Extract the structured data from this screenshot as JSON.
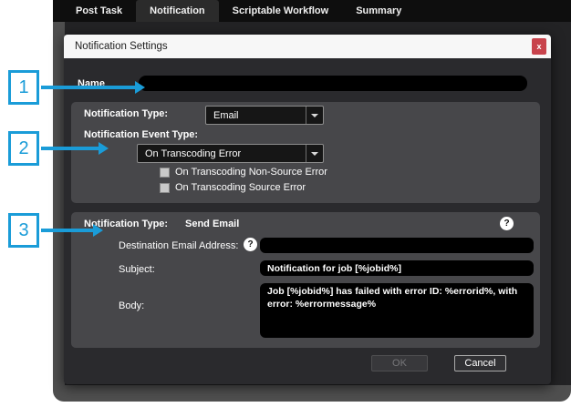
{
  "colors": {
    "accent_blue": "#1a9cd8",
    "close_red": "#c8434c",
    "dialog_bg": "#2a2a2d",
    "section_bg": "#47474a"
  },
  "tabs": [
    {
      "label": "Post Task",
      "selected": false
    },
    {
      "label": "Notification",
      "selected": true
    },
    {
      "label": "Scriptable Workflow",
      "selected": false
    },
    {
      "label": "Summary",
      "selected": false
    }
  ],
  "annotations": [
    {
      "number": "1"
    },
    {
      "number": "2"
    },
    {
      "number": "3"
    }
  ],
  "dialog": {
    "title": "Notification Settings",
    "close_glyph": "x",
    "name": {
      "label": "Name",
      "value": ""
    },
    "type_section": {
      "type_label": "Notification Type:",
      "type_value": "Email",
      "event_label": "Notification Event Type:",
      "event_value": "On Transcoding Error",
      "checkboxes": [
        {
          "label": "On Transcoding Non-Source Error",
          "checked": false
        },
        {
          "label": "On Transcoding Source Error",
          "checked": false
        }
      ]
    },
    "email_section": {
      "header_label": "Notification Type:",
      "header_value": "Send Email",
      "help_glyph": "?",
      "destination": {
        "label": "Destination Email Address:",
        "value": ""
      },
      "subject": {
        "label": "Subject:",
        "value": "Notification for job [%jobid%]"
      },
      "body": {
        "label": "Body:",
        "value": "Job [%jobid%] has failed with error ID: %errorid%, with error: %errormessage%"
      }
    },
    "buttons": {
      "ok_label": "OK",
      "cancel_label": "Cancel"
    }
  }
}
